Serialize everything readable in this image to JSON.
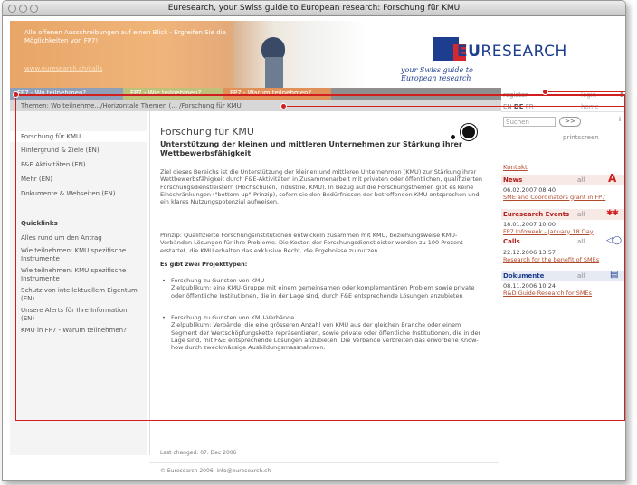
{
  "window": {
    "title": "Euresearch, your Swiss guide to European research: Forschung für KMU"
  },
  "banner": {
    "promo_text": "Alle offenen Ausschreibungen auf einen Blick - Ergreifen Sie die Möglichkeiten von FP7!",
    "promo_link": "www.euresearch.ch/calls",
    "logo_word_bold": "EU",
    "logo_word_rest": "RESEARCH",
    "logo_tagline": "your Swiss guide to European research"
  },
  "tabs": [
    {
      "label": "FP7 - Wo teilnehmen?"
    },
    {
      "label": "FP7 - Wie teilnehmen?"
    },
    {
      "label": "FP7 - Warum teilnehmen?"
    }
  ],
  "breadcrumb": "Themen: Wo teilnehme.../Horizontale Themen (... /Forschung für KMU",
  "account": {
    "register": "register",
    "login": "login",
    "home": "home"
  },
  "languages": {
    "en": "EN",
    "de": "DE",
    "fr": "FR"
  },
  "search": {
    "placeholder": "Suchen",
    "go": ">>",
    "printscreen": "printscreen"
  },
  "sidebar": {
    "items": [
      "Forschung für KMU",
      "Hintergrund & Ziele (EN)",
      "F&E Aktivitäten (EN)",
      "Mehr (EN)",
      "Dokumente & Webseiten (EN)"
    ],
    "quicklinks_title": "Quicklinks",
    "quicklinks": [
      "Alles rund um den Antrag",
      "Wie teilnehmen: KMU spezifische Instrumente",
      "Wie teilnehmen: KMU spezifische Instrumente",
      "Schutz von intellektuellem Eigentum (EN)",
      "Unsere Alerts für Ihre Information (EN)",
      "KMU in FP7 - Warum teilnehmen?"
    ]
  },
  "main": {
    "title": "Forschung für KMU",
    "subtitle": "Unterstützung der kleinen und mittleren Unternehmen zur Stärkung ihrer Wettbewerbsfähigkeit",
    "p1": "Ziel dieses Bereichs ist die Unterstützung der kleinen und mittleren Unternehmen (KMU) zur Stärkung ihrer Wettbewerbsfähigkeit durch F&E-Aktivitäten in Zusammenarbeit mit privaten oder öffentlichen, qualifizierten Forschungsdienstleistern (Hochschulen, Industrie, KMU). In Bezug auf die Forschungsthemen gibt es keine Einschränkungen (\"bottom-up\"-Prinzip), sofern sie den Bedürfnissen der betreffenden KMU entsprechen und ein klares Nutzungspotenzial aufweisen.",
    "p2": "Prinzip: Qualifizierte Forschungsinstitutionen entwickeln zusammen mit KMU, beziehungsweise KMU-Verbänden Lösungen für ihre Probleme. Die Kosten der Forschungsdienstleister werden zu 100 Prozent erstattet, die KMU erhalten das exklusive Recht, die Ergebnisse zu nutzen.",
    "projects_head": "Es gibt zwei Projekttypen:",
    "b1_title": "Forschung zu Gunsten von KMU",
    "b1_text": "Zielpublikum: eine KMU-Gruppe mit einem gemeinsamen oder komplementären Problem sowie private oder öffentliche Institutionen, die in der Lage sind, durch F&E entsprechende Lösungen anzubieten",
    "b2_title": "Forschung zu Gunsten von KMU-Verbände",
    "b2_text": "Zielpublikum: Verbände, die eine grösseren Anzahl von KMU aus der gleichen Branche oder einem Segment der Wertschöpfungskette repräsentieren, sowie private oder öffentliche Institutionen, die in der Lage sind, mit F&E entsprechende Lösungen anzubieten. Die Verbände verbreiten das erworbene Know-how durch zweckmässige Ausbildungsmassnahmen."
  },
  "footer": {
    "changed": "Last changed:  07. Dec 2006",
    "copyright": "© Euresearch 2006, info@euresearch.ch"
  },
  "right": {
    "kontakt": "Kontakt",
    "all": "all",
    "news": {
      "title": "News",
      "date": "06.02.2007 08:40",
      "link": "SME and Coordinators grant in FP7"
    },
    "events": {
      "title": "Euresearch Events",
      "date": "18.01.2007 10:00",
      "link": "FP7 Infoweek - January 18 Day"
    },
    "calls": {
      "title": "Calls",
      "date": "22.12.2006 13:57",
      "link": "Research for the benefit of SMEs"
    },
    "docs": {
      "title": "Dokumente",
      "date": "08.11.2006 10:24",
      "link": "R&D Guide Research for SMEs"
    }
  },
  "colors": {
    "accent_red": "#d11e1e",
    "brand_blue": "#1d3d8f",
    "tab1": "#8f9fb8",
    "tab2": "#bfc17a",
    "tab3": "#e0915a"
  }
}
